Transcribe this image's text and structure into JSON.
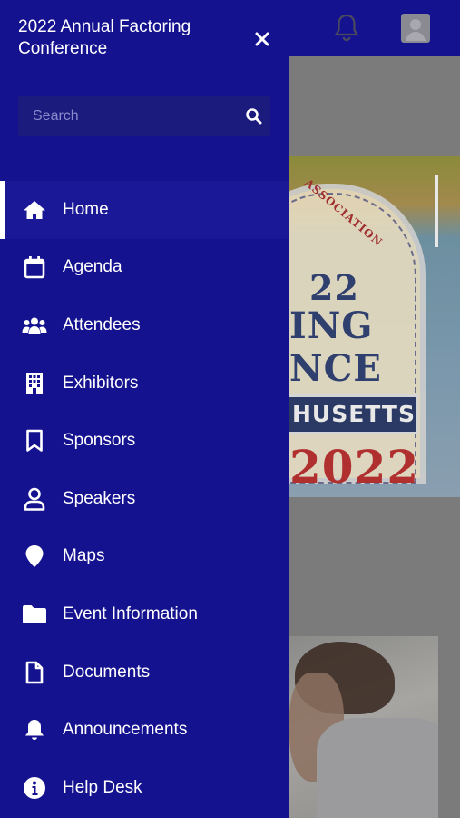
{
  "app": {
    "title": "2022 Annual Factoring Conference"
  },
  "search": {
    "placeholder": "Search",
    "value": ""
  },
  "menu": {
    "active": "Home",
    "items": [
      {
        "label": "Home",
        "icon": "home-icon"
      },
      {
        "label": "Agenda",
        "icon": "calendar-icon"
      },
      {
        "label": "Attendees",
        "icon": "users-icon"
      },
      {
        "label": "Exhibitors",
        "icon": "building-icon"
      },
      {
        "label": "Sponsors",
        "icon": "bookmark-icon"
      },
      {
        "label": "Speakers",
        "icon": "user-icon"
      },
      {
        "label": "Maps",
        "icon": "map-pin-icon"
      },
      {
        "label": "Event Information",
        "icon": "folder-icon"
      },
      {
        "label": "Documents",
        "icon": "document-icon"
      },
      {
        "label": "Announcements",
        "icon": "bell-icon"
      },
      {
        "label": "Help Desk",
        "icon": "info-icon"
      }
    ]
  },
  "header_icons": [
    "bell-icon",
    "user-avatar"
  ],
  "banner": {
    "lines": [
      "ASSOCIATION",
      "22",
      "ING",
      "NCE",
      "HUSETTS",
      "2022"
    ]
  },
  "colors": {
    "drawer": "#15128f",
    "active_item": "#1a1896",
    "text": "#ffffff"
  }
}
